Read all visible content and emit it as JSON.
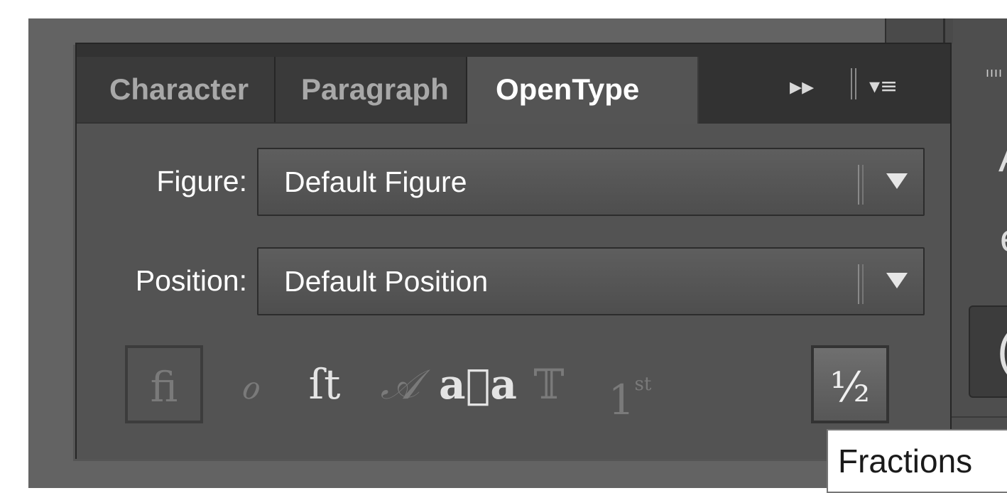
{
  "tabs": [
    {
      "label": "Character"
    },
    {
      "label": "Paragraph"
    },
    {
      "label": "OpenType"
    }
  ],
  "tab_icons": {
    "more": "double-chevron-right-icon",
    "menu": "panel-menu-icon"
  },
  "figure": {
    "label": "Figure:",
    "value": "Default Figure"
  },
  "position": {
    "label": "Position:",
    "value": "Default Position"
  },
  "features": {
    "ligatures": "fi",
    "swash": "ℴ",
    "discretionary": "ſt",
    "titling": "𝒜",
    "contextual": "a⃗a",
    "stylistic": "𝕋",
    "ordinal_base": "1",
    "ordinal_sup": "st",
    "fractions": "½"
  },
  "tooltip": {
    "text": "Fractions"
  },
  "colors": {
    "panel": "#535353",
    "tab_active": "#545454",
    "tab_inactive": "#3a3a3a"
  }
}
